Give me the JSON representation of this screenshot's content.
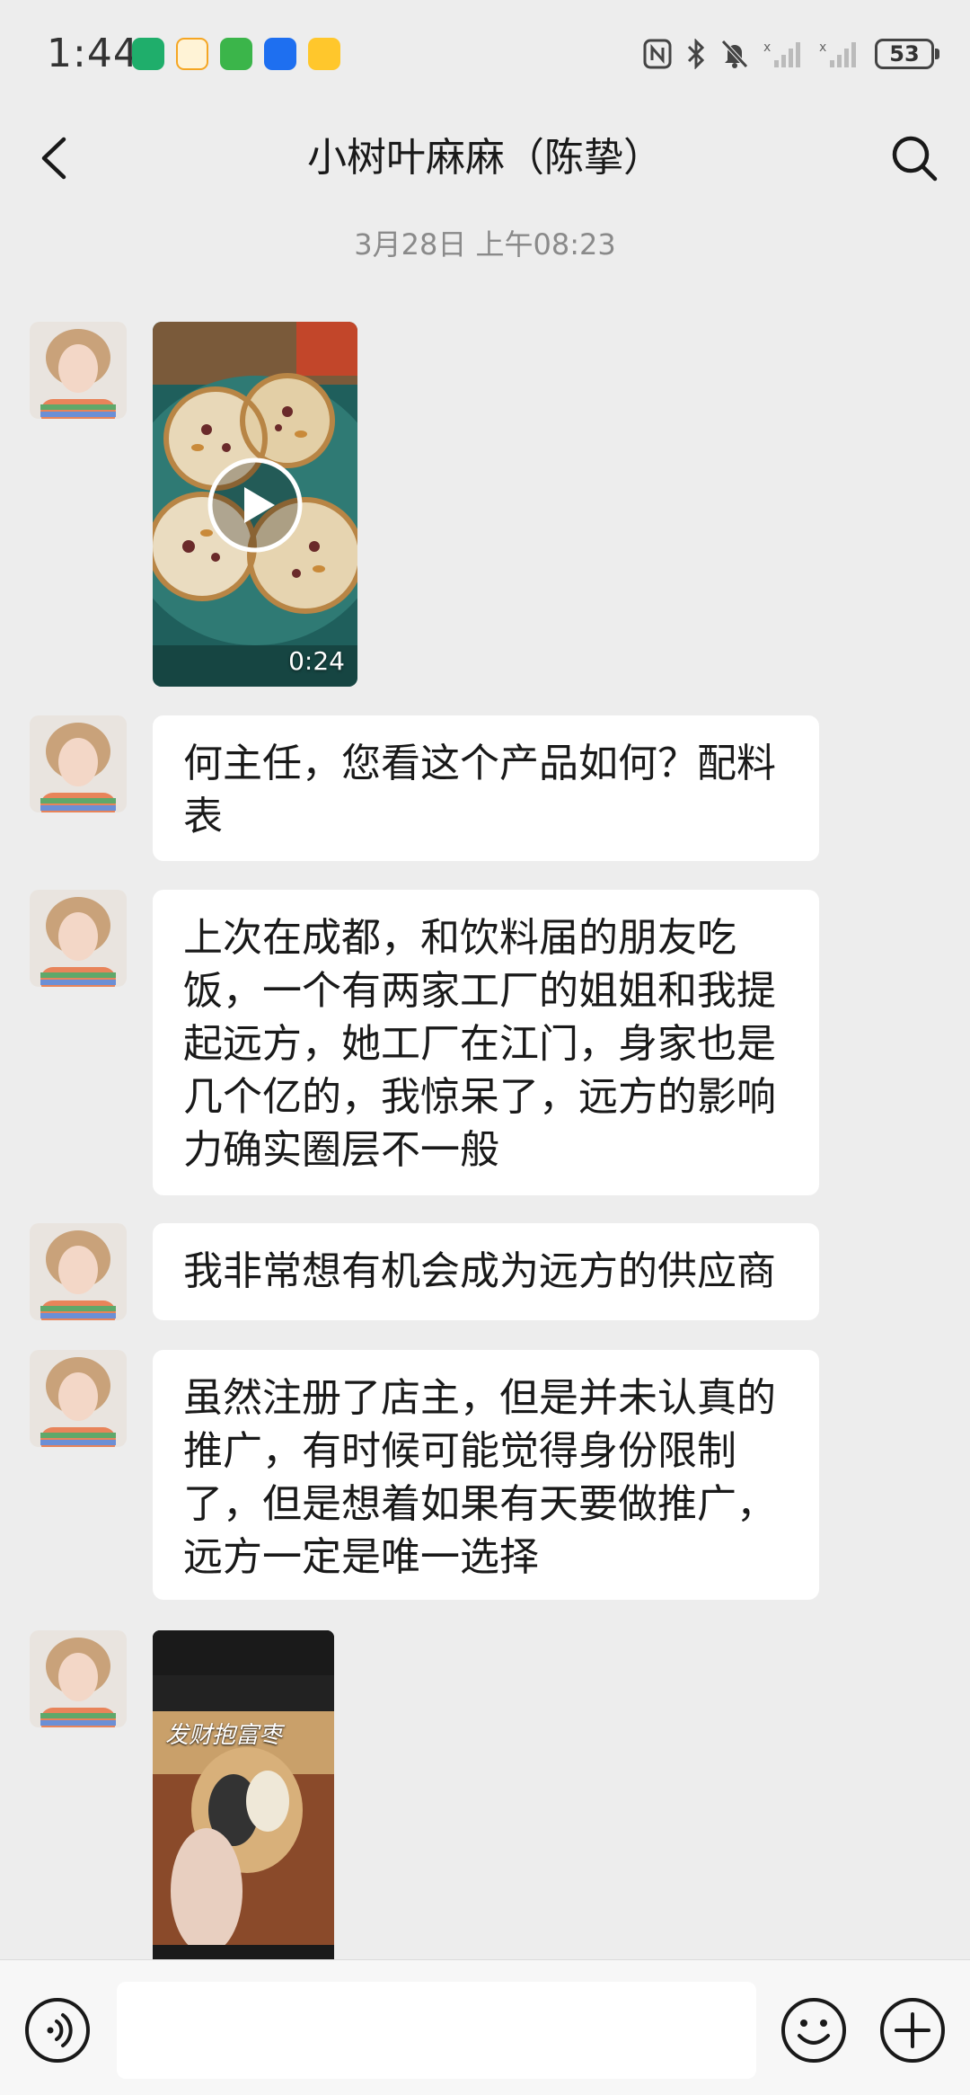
{
  "status_bar": {
    "time": "1:44",
    "battery": "53",
    "icons": [
      "nfc-icon",
      "bluetooth-icon",
      "mute-icon",
      "signal-icon",
      "signal-icon"
    ]
  },
  "header": {
    "title": "小树叶麻麻（陈挚）",
    "back_icon": "chevron-left-icon",
    "search_icon": "search-icon"
  },
  "timestamp": "3月28日 上午08:23",
  "messages": [
    {
      "type": "video",
      "duration": "0:24"
    },
    {
      "type": "text",
      "text": "何主任，您看这个产品如何？配料表"
    },
    {
      "type": "text",
      "text": "上次在成都，和饮料届的朋友吃饭，一个有两家工厂的姐姐和我提起远方，她工厂在江门，身家也是几个亿的，我惊呆了，远方的影响力确实圈层不一般"
    },
    {
      "type": "text",
      "text": "我非常想有机会成为远方的供应商"
    },
    {
      "type": "text",
      "text": "虽然注册了店主，但是并未认真的推广，有时候可能觉得身份限制了，但是想着如果有天要做推广，远方一定是唯一选择"
    },
    {
      "type": "image",
      "caption": "发财抱富枣"
    }
  ],
  "input_bar": {
    "value": "",
    "placeholder": ""
  },
  "colors": {
    "background": "#ededed",
    "bubble": "#ffffff",
    "text": "#191919",
    "muted": "#8a8a8a"
  }
}
